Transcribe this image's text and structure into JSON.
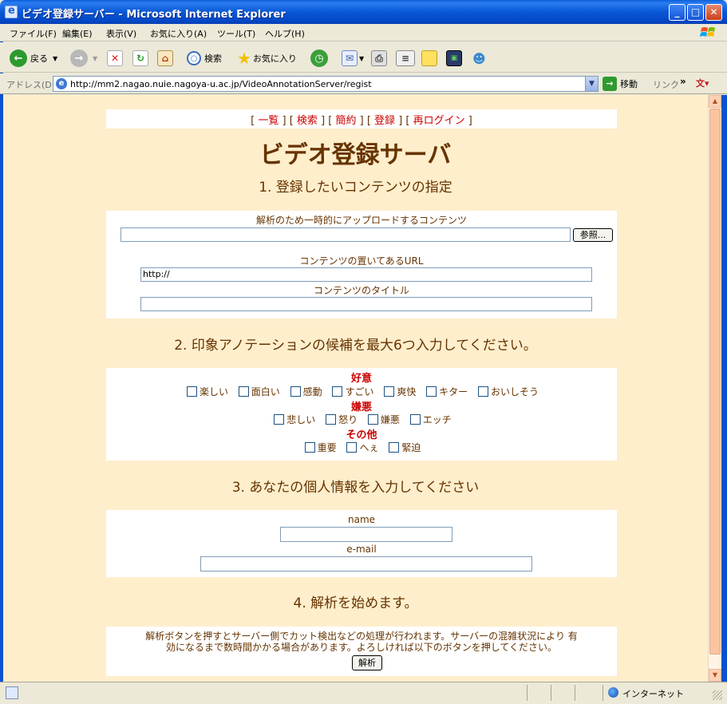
{
  "window": {
    "title": "ビデオ登録サーバー - Microsoft Internet Explorer",
    "min": "_",
    "max": "□",
    "close": "✕"
  },
  "menu": [
    "ファイル(F)",
    "編集(E)",
    "表示(V)",
    "お気に入り(A)",
    "ツール(T)",
    "ヘルプ(H)"
  ],
  "toolbar": {
    "back": "戻る",
    "search": "検索",
    "favorites": "お気に入り"
  },
  "address": {
    "label": "アドレス(D)",
    "url": "http://mm2.nagao.nuie.nagoya-u.ac.jp/VideoAnnotationServer/regist",
    "go": "移動",
    "links": "リンク"
  },
  "nav": {
    "items": [
      "一覧",
      "検索",
      "簡約",
      "登録",
      "再ログイン"
    ]
  },
  "page": {
    "title": "ビデオ登録サーバ",
    "section1": {
      "heading": "1. 登録したいコンテンツの指定",
      "upload_label": "解析のため一時的にアップロードするコンテンツ",
      "browse": "参照...",
      "url_label": "コンテンツの置いてあるURL",
      "url_value": "http://",
      "title_label": "コンテンツのタイトル",
      "title_value": ""
    },
    "section2": {
      "heading": "2. 印象アノテーションの候補を最大6つ入力してください。",
      "groups": [
        {
          "name": "好意",
          "options": [
            "楽しい",
            "面白い",
            "感動",
            "すごい",
            "爽快",
            "キター",
            "おいしそう"
          ]
        },
        {
          "name": "嫌悪",
          "options": [
            "悲しい",
            "怒り",
            "嫌悪",
            "エッチ"
          ]
        },
        {
          "name": "その他",
          "options": [
            "重要",
            "へぇ",
            "緊迫"
          ]
        }
      ]
    },
    "section3": {
      "heading": "3. あなたの個人情報を入力してください",
      "name_label": "name",
      "name_value": "",
      "email_label": "e-mail",
      "email_value": ""
    },
    "section4": {
      "heading": "4. 解析を始めます。",
      "note_line1": "解析ボタンを押すとサーバー側でカット検出などの処理が行われます。サーバーの混雑状況により 有",
      "note_line2": "効になるまで数時間かかる場合があります。よろしければ以下のボタンを押してください。",
      "submit": "解析"
    }
  },
  "status": {
    "zone": "インターネット"
  },
  "colors": {
    "page_bg": "#ffeecc",
    "text_brown": "#663300",
    "link_red": "#cc0000",
    "title_blue": "#0a58d6"
  }
}
